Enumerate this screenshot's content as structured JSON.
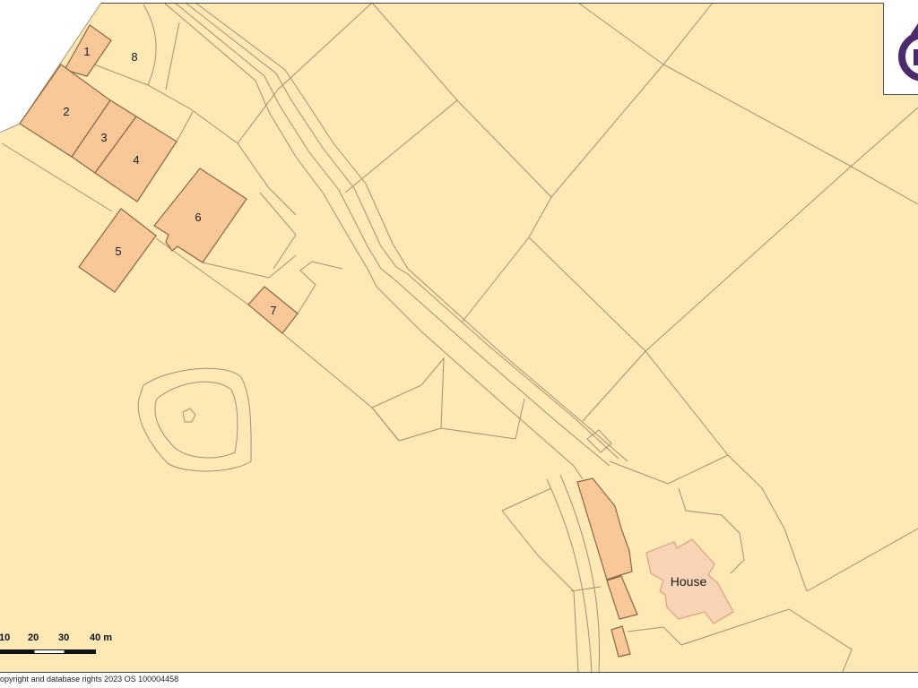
{
  "map": {
    "plot_labels": [
      "1",
      "2",
      "3",
      "4",
      "5",
      "6",
      "7",
      "8"
    ],
    "house_label": "House",
    "colors": {
      "map_background": "#FDE8B6",
      "boundary_line": "#A88E70",
      "building_fill": "#F8C898",
      "building_outline": "#8A6647",
      "house_fill": "#FAD4B6",
      "house_outline": "#D9A27E",
      "logo_purple": "#4B2B6C"
    }
  },
  "logo": {
    "icon": "os-logo-icon"
  },
  "scale_bar": {
    "labels": [
      "10",
      "20",
      "30",
      "40 m"
    ]
  },
  "copyright": "opyright and database rights 2023 OS 100004458"
}
